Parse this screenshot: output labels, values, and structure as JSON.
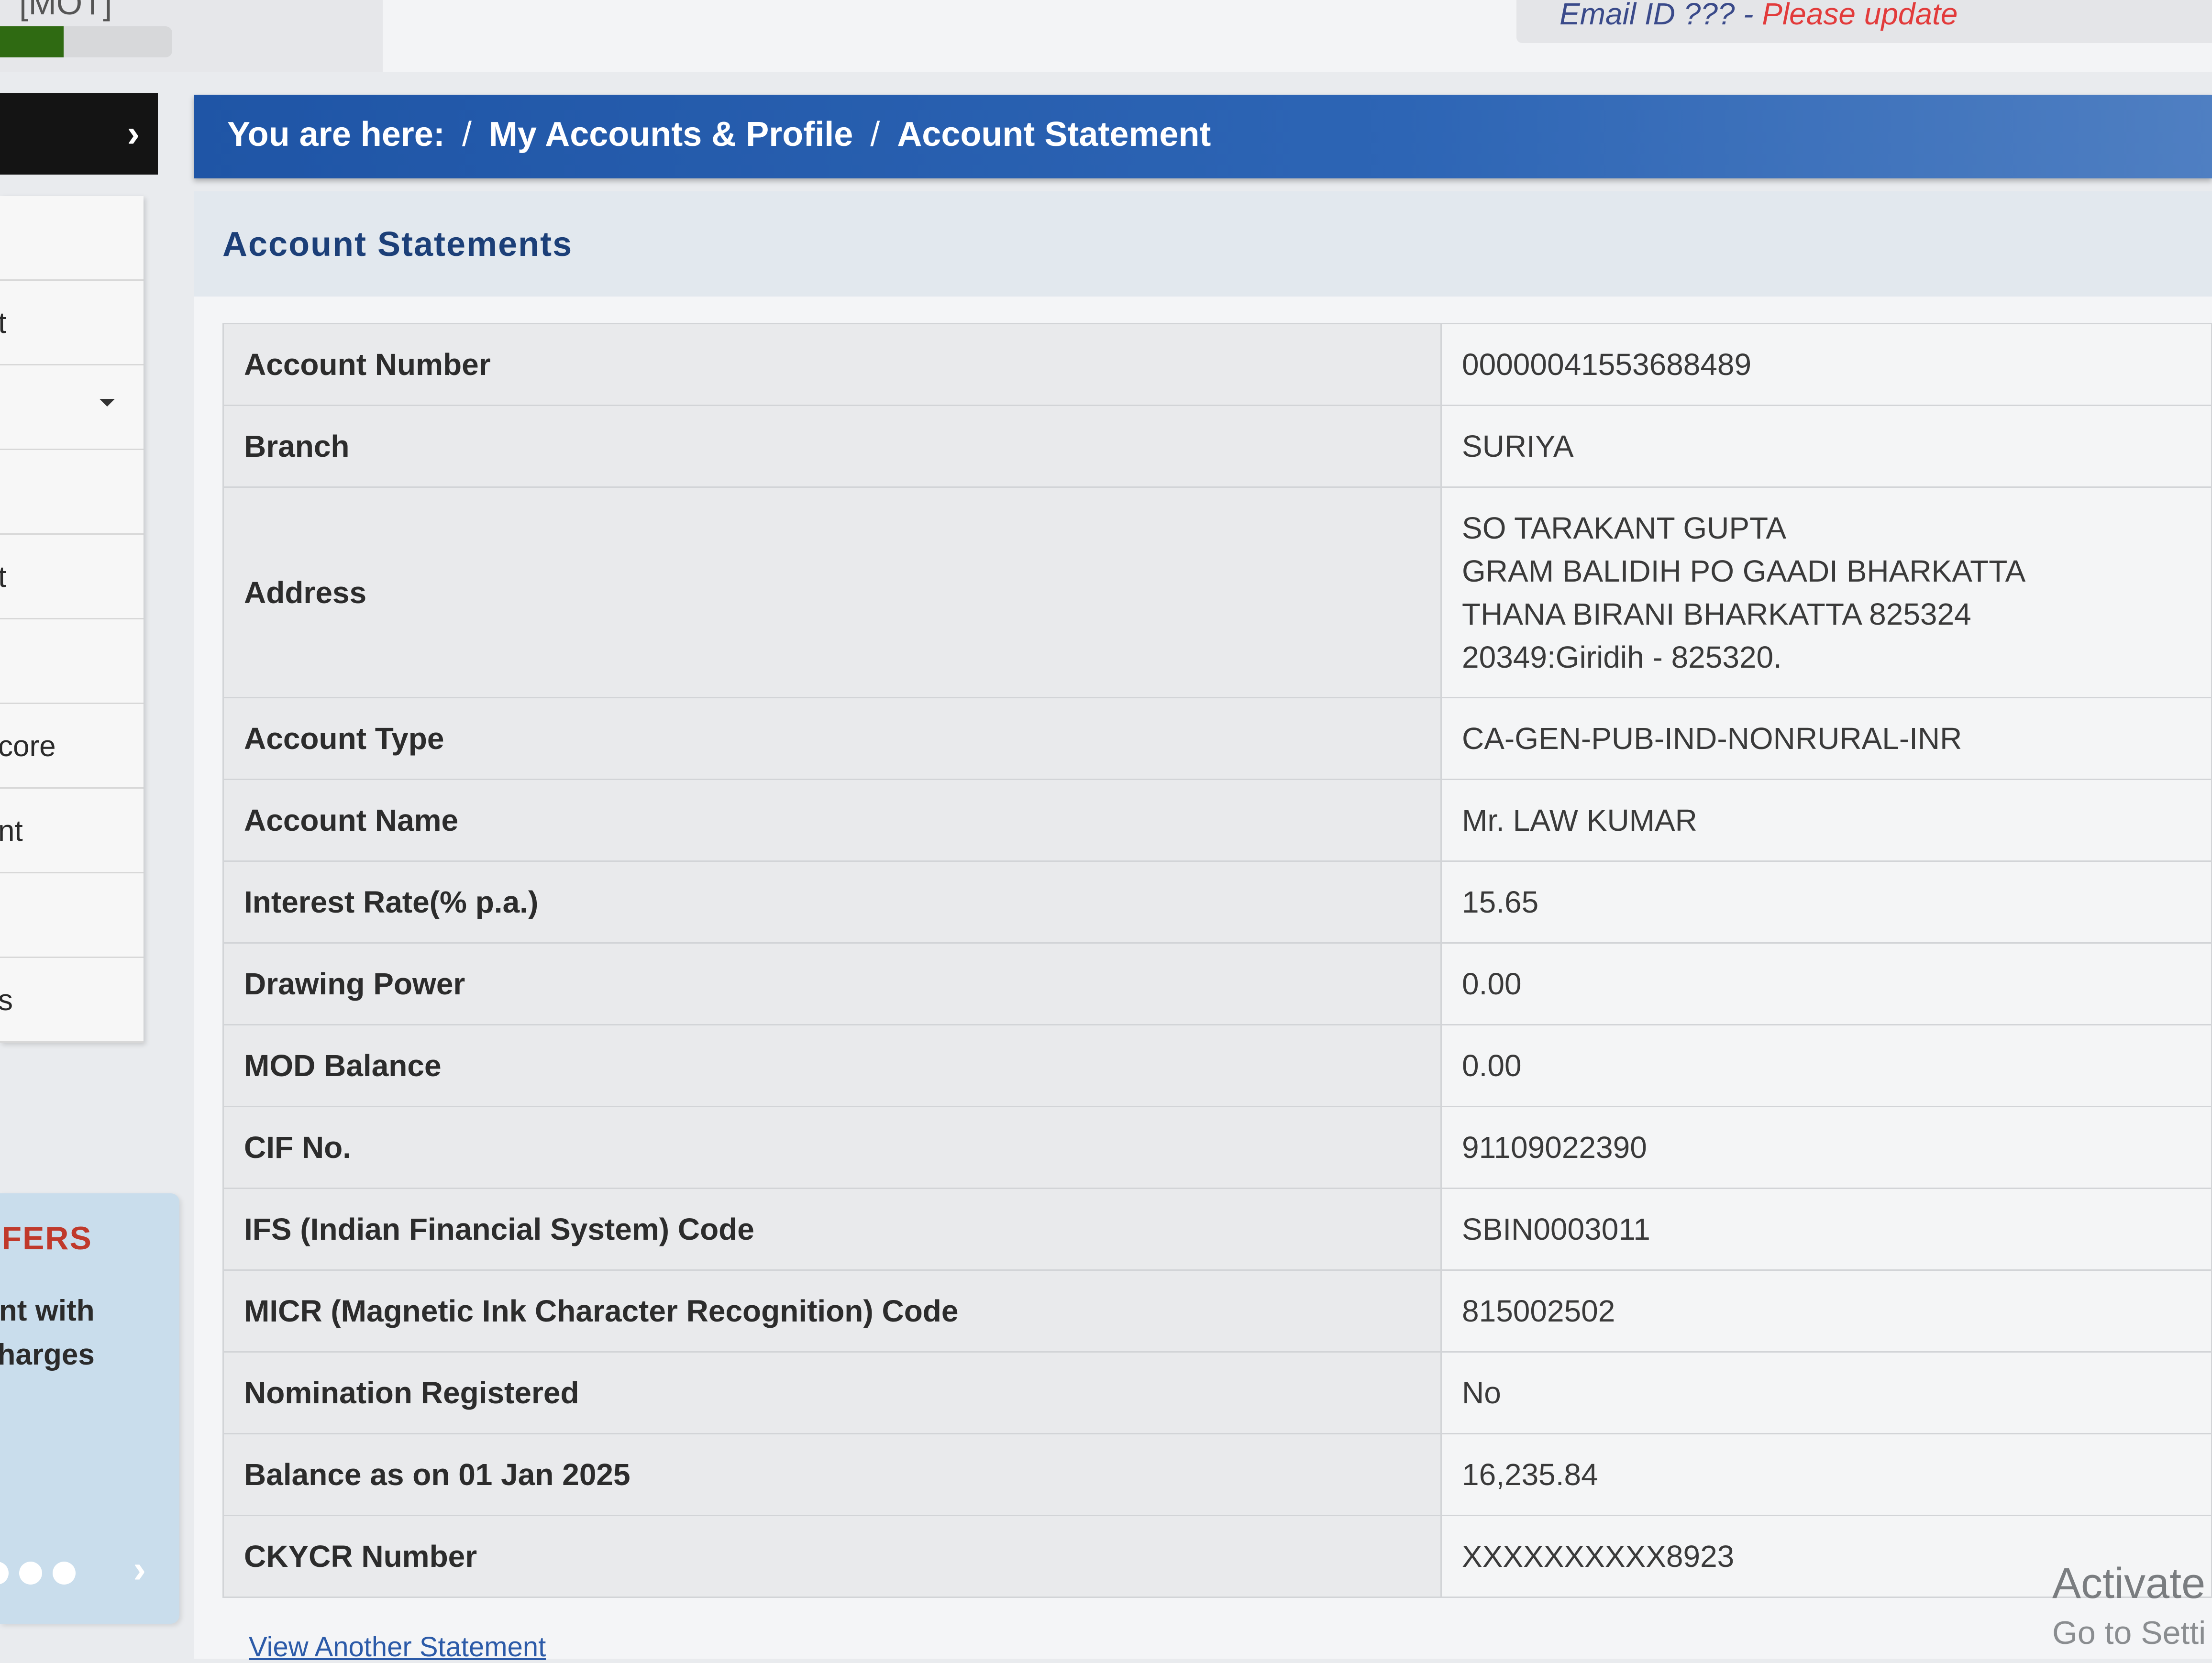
{
  "header": {
    "top_left_text": "[MOT]",
    "progress_percent": 37,
    "email_notice": "Email ID ??? - ",
    "email_link": "Please update"
  },
  "sidebar": {
    "items": [
      {
        "label": ""
      },
      {
        "label": "t"
      },
      {
        "label": "",
        "has_caret": true
      },
      {
        "label": ""
      },
      {
        "label": "t"
      },
      {
        "label": ""
      },
      {
        "label": "core"
      },
      {
        "label": "nt"
      },
      {
        "label": ""
      },
      {
        "label": "s"
      }
    ],
    "offers": {
      "title": "FFERS",
      "text_line1": "unt with",
      "text_line2": "charges"
    }
  },
  "breadcrumb": {
    "prefix": "You are here:",
    "separator": "/",
    "items": [
      "My Accounts & Profile",
      "Account Statement"
    ]
  },
  "panel": {
    "title": "Account Statements",
    "rows": [
      {
        "key": "Account Number",
        "value": "00000041553688489"
      },
      {
        "key": "Branch",
        "value": "SURIYA"
      },
      {
        "key": "Address",
        "lines": [
          "SO TARAKANT GUPTA",
          "GRAM BALIDIH PO GAADI BHARKATTA",
          "THANA BIRANI BHARKATTA 825324",
          "20349:Giridih  - 825320."
        ]
      },
      {
        "key": "Account Type",
        "value": "CA-GEN-PUB-IND-NONRURAL-INR"
      },
      {
        "key": "Account Name",
        "value": "Mr. LAW KUMAR"
      },
      {
        "key": "Interest Rate(% p.a.)",
        "value": "15.65"
      },
      {
        "key": "Drawing Power",
        "value": "0.00"
      },
      {
        "key": "MOD Balance",
        "value": "0.00"
      },
      {
        "key": "CIF No.",
        "value": "91109022390"
      },
      {
        "key": "IFS (Indian Financial System) Code",
        "value": "SBIN0003011"
      },
      {
        "key": "MICR (Magnetic Ink Character Recognition) Code",
        "value": "815002502"
      },
      {
        "key": "Nomination Registered",
        "value": "No"
      },
      {
        "key": "Balance as on 01 Jan 2025",
        "value": "16,235.84"
      },
      {
        "key": "CKYCR Number",
        "value": "XXXXXXXXXX8923"
      }
    ],
    "view_another": "View Another Statement"
  },
  "watermark": {
    "title": "Activate",
    "subtitle": "Go to Setti"
  }
}
